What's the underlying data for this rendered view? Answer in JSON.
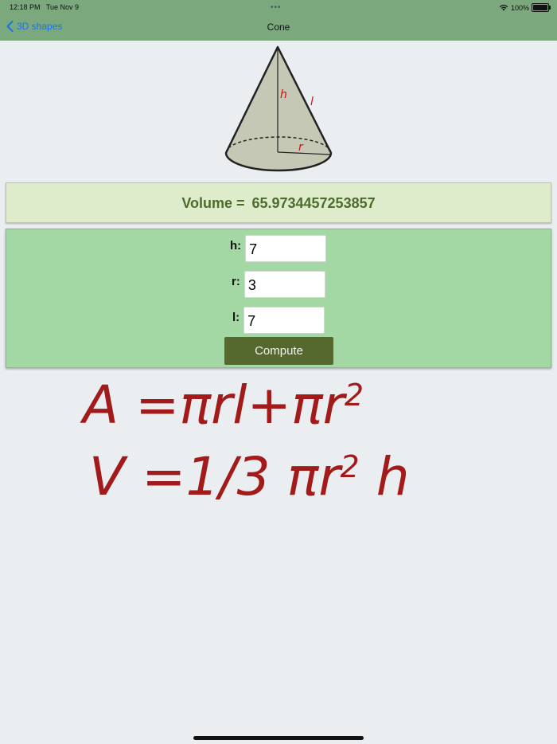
{
  "status_bar": {
    "time": "12:18 PM",
    "date": "Tue Nov 9",
    "battery": "100%"
  },
  "nav": {
    "back_label": "3D shapes",
    "title": "Cone"
  },
  "diagram": {
    "label_h": "h",
    "label_l": "l",
    "label_r": "r"
  },
  "result": {
    "label": "Volume =",
    "value": "65.9734457253857"
  },
  "inputs": [
    {
      "label": "h:",
      "value": "7"
    },
    {
      "label": "r:",
      "value": "3"
    },
    {
      "label": "l:",
      "value": "7"
    }
  ],
  "compute_label": "Compute",
  "formulas": {
    "area": {
      "lhs": "A",
      "rhs": "=πrl+πr",
      "exp": "2"
    },
    "volume": {
      "lhs": "V",
      "rhs": "=1/3 πr",
      "exp": "2",
      "tail": "h"
    }
  },
  "colors": {
    "nav_bar": "#7ba87c",
    "result_bg": "#deeccb",
    "form_bg": "#a3d7a4",
    "button": "#55692f",
    "formula": "#a31a1a",
    "back_link": "#1a73e8"
  }
}
